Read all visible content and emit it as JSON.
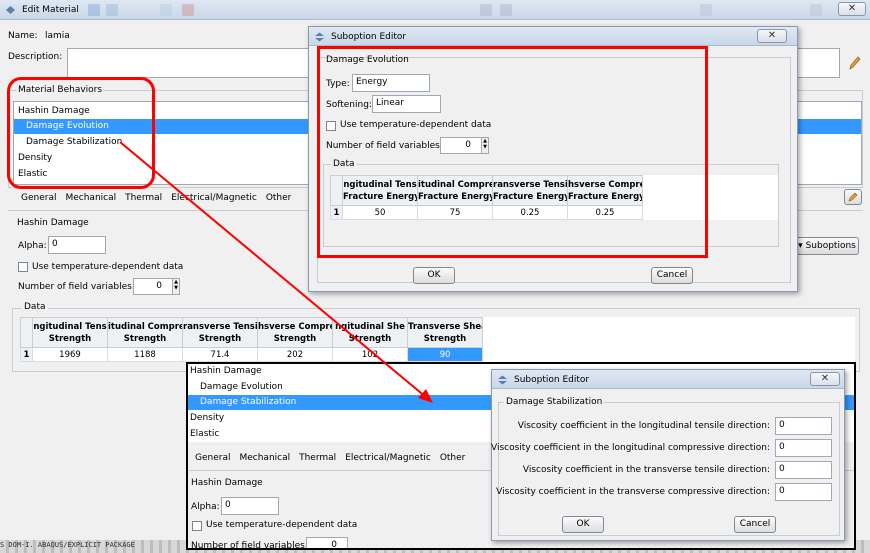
{
  "colors": {
    "selection": "#3399ff",
    "highlight_red": "#ff0000",
    "titlebar": "#c9d7e8"
  },
  "main": {
    "title": "Edit Material",
    "name_label": "Name:",
    "name_value": "lamia",
    "description_label": "Description:",
    "behaviors_title": "Material Behaviors",
    "behaviors": [
      "Hashin Damage",
      "Damage Evolution",
      "Damage Stabilization",
      "Density",
      "Elastic"
    ],
    "tabs": [
      "General",
      "Mechanical",
      "Thermal",
      "Electrical/Magnetic",
      "Other"
    ],
    "section_title": "Hashin Damage",
    "alpha_label": "Alpha:",
    "alpha_value": "0",
    "temp_dep_label": "Use temperature-dependent data",
    "field_vars_label": "Number of field variables:",
    "field_vars_value": "0",
    "suboptions_label": "Suboptions",
    "data_title": "Data",
    "table": {
      "headers": [
        [
          "ngitudinal Tens",
          "Strength"
        ],
        [
          "itudinal Compre",
          "Strength"
        ],
        [
          "ransverse Tensi",
          "Strength"
        ],
        [
          "hsverse Compres",
          "Strength"
        ],
        [
          "ngitudinal She",
          "Strength"
        ],
        [
          "Transverse Shea",
          "Strength"
        ]
      ],
      "row_number": "1",
      "values": [
        "1969",
        "1188",
        "71.4",
        "202",
        "102",
        "90"
      ]
    }
  },
  "dialog1": {
    "title": "Suboption Editor",
    "section_title": "Damage Evolution",
    "type_label": "Type:",
    "type_value": "Energy",
    "softening_label": "Softening:",
    "softening_value": "Linear",
    "temp_dep_label": "Use temperature-dependent data",
    "field_vars_label": "Number of field variables:",
    "field_vars_value": "0",
    "data_title": "Data",
    "table": {
      "headers": [
        [
          "ngitudinal Tens",
          "Fracture Energy"
        ],
        [
          "itudinal Compre",
          "Fracture Energy"
        ],
        [
          "ransverse Tensi",
          "Fracture Energy"
        ],
        [
          "hsverse Compres",
          "Fracture Energy"
        ]
      ],
      "row_number": "1",
      "values": [
        "50",
        "75",
        "0.25",
        "0.25"
      ]
    },
    "ok_label": "OK",
    "cancel_label": "Cancel"
  },
  "inset": {
    "behaviors": [
      "Hashin Damage",
      "Damage Evolution",
      "Damage Stabilization",
      "Density",
      "Elastic"
    ],
    "tabs": [
      "General",
      "Mechanical",
      "Thermal",
      "Electrical/Magnetic",
      "Other"
    ],
    "section_title": "Hashin Damage",
    "alpha_label": "Alpha:",
    "alpha_value": "0",
    "temp_dep_label": "Use temperature-dependent data",
    "field_vars_label": "Number of field variables:",
    "field_vars_value": "0"
  },
  "dialog2": {
    "title": "Suboption Editor",
    "section_title": "Damage Stabilization",
    "rows": [
      {
        "label": "Viscosity coefficient in the longitudinal tensile direction:",
        "value": "0"
      },
      {
        "label": "Viscosity coefficient in the longitudinal compressive direction:",
        "value": "0"
      },
      {
        "label": "Viscosity coefficient in the transverse tensile direction:",
        "value": "0"
      },
      {
        "label": "Viscosity coefficient in the transverse compressive direction:",
        "value": "0"
      }
    ],
    "ok_label": "OK",
    "cancel_label": "Cancel"
  },
  "status": {
    "text": "S DOM-I. ABAQUS/EXPLICIT PACKAGE"
  }
}
